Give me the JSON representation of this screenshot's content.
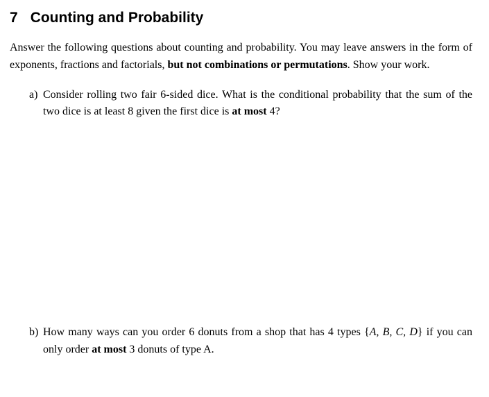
{
  "section": {
    "number": "7",
    "title": "Counting and Probability"
  },
  "intro": {
    "part1": "Answer the following questions about counting and probability. You may leave answers in the form of exponents, fractions and factorials, ",
    "bold": "but not combinations or permutations",
    "part2": ". Show your work."
  },
  "items": {
    "a": {
      "marker": "a)",
      "part1": "Consider rolling two fair 6-sided dice. What is the conditional probability that the sum of the two dice is at least 8 given the first dice is ",
      "bold1": "at most",
      "part2": " 4?"
    },
    "b": {
      "marker": "b)",
      "part1": "How many ways can you order 6 donuts from a shop that has 4 types {",
      "math": "A, B, C, D",
      "part2": "} if you can only order ",
      "bold1": "at most",
      "part3": " 3 donuts of type A."
    }
  }
}
